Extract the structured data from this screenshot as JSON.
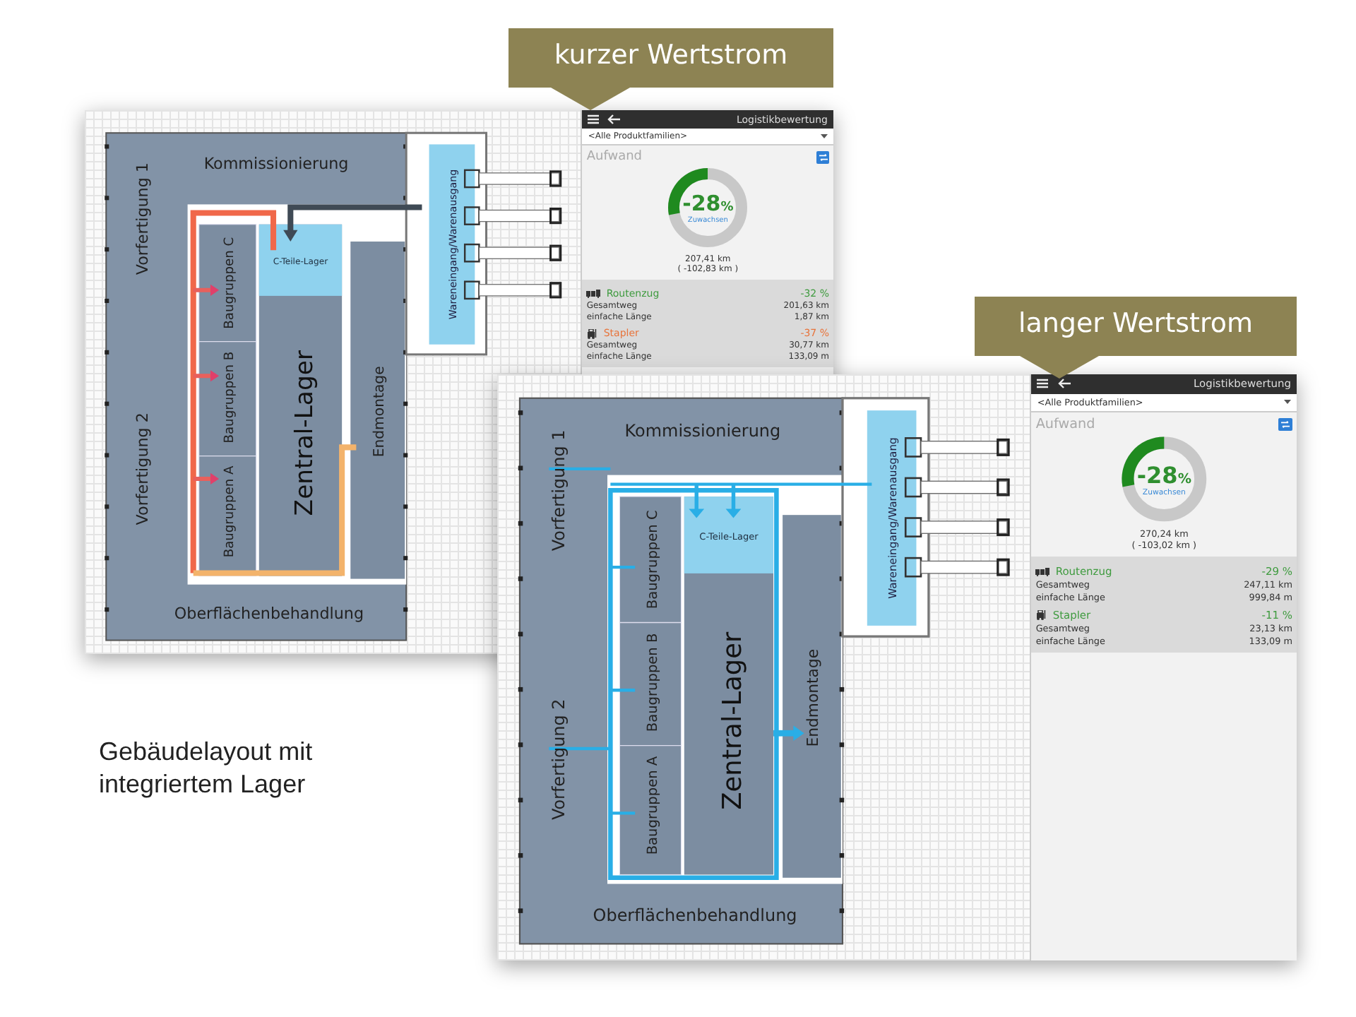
{
  "callouts": [
    {
      "text": "kurzer Wertstrom"
    },
    {
      "text": "langer Wertstrom"
    }
  ],
  "caption": {
    "lines": [
      "Gebäudelayout mit",
      "integriertem Lager"
    ]
  },
  "windows": [
    {
      "kind": "short",
      "title": "Logistikbewertung",
      "filter": "<Alle Produktfamilien>",
      "section": "Aufwand",
      "donut": {
        "value": "-28",
        "unit": "%",
        "caption": "Zuwachsen"
      },
      "total": "207,41 km",
      "delta": "( -102,83 km )",
      "transports": [
        {
          "kind": "train",
          "name": "Routenzug",
          "change": "-32 %",
          "color": "#3f9b3f",
          "rows": [
            {
              "label": "Gesamtweg",
              "value": "201,63 km"
            },
            {
              "label": "einfache Länge",
              "value": "1,87 km"
            }
          ]
        },
        {
          "kind": "forklift",
          "name": "Stapler",
          "change": "-37 %",
          "color": "#e8743b",
          "rows": [
            {
              "label": "Gesamtweg",
              "value": "30,77 km"
            },
            {
              "label": "einfache Länge",
              "value": "133,09 m"
            }
          ]
        }
      ],
      "plan": {
        "picking": "Kommissionierung",
        "prefab_1": "Vorfertigung 1",
        "prefab_2": "Vorfertigung 2",
        "assembly_groups": [
          "Baugruppen C",
          "Baugruppen B",
          "Baugruppen A"
        ],
        "small_parts_store": "C-Teile-Lager",
        "central_store": "Zentral-Lager",
        "final_assembly": "Endmontage",
        "surface_treatment": "Oberflächenbehandlung",
        "goods_gate": "Wareneingang/Warenausgang"
      }
    },
    {
      "kind": "long",
      "title": "Logistikbewertung",
      "filter": "<Alle Produktfamilien>",
      "section": "Aufwand",
      "donut": {
        "value": "-28",
        "unit": "%",
        "caption": "Zuwachsen"
      },
      "total": "270,24 km",
      "delta": "( -103,02 km )",
      "transports": [
        {
          "kind": "train",
          "name": "Routenzug",
          "change": "-29 %",
          "color": "#3f9b3f",
          "rows": [
            {
              "label": "Gesamtweg",
              "value": "247,11 km"
            },
            {
              "label": "einfache Länge",
              "value": "999,84 m"
            }
          ]
        },
        {
          "kind": "forklift",
          "name": "Stapler",
          "change": "-11 %",
          "color": "#3f9b3f",
          "rows": [
            {
              "label": "Gesamtweg",
              "value": "23,13 km"
            },
            {
              "label": "einfache Länge",
              "value": "133,09 m"
            }
          ]
        }
      ],
      "plan": {
        "picking": "Kommissionierung",
        "prefab_1": "Vorfertigung 1",
        "prefab_2": "Vorfertigung 2",
        "assembly_groups": [
          "Baugruppen C",
          "Baugruppen B",
          "Baugruppen A"
        ],
        "small_parts_store": "C-Teile-Lager",
        "central_store": "Zentral-Lager",
        "final_assembly": "Endmontage",
        "surface_treatment": "Oberflächenbehandlung",
        "goods_gate": "Wareneingang/Warenausgang"
      }
    }
  ]
}
